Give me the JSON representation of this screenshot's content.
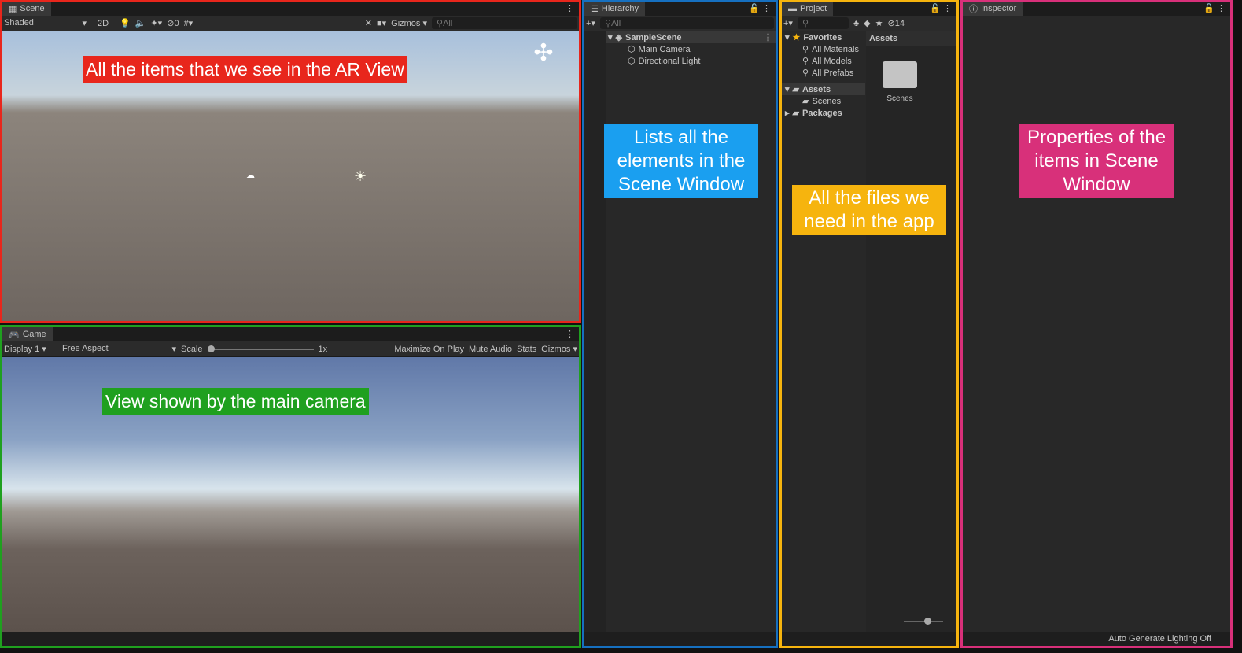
{
  "scene": {
    "tab": "Scene",
    "shading": "Shaded",
    "mode_2d": "2D",
    "hidden_count": "0",
    "gizmos": "Gizmos",
    "search_placeholder": "All",
    "annotation": "All the items that we see in the AR View",
    "annotation_color": "#e8261c",
    "border_color": "#e8261c"
  },
  "game": {
    "tab": "Game",
    "display": "Display 1",
    "aspect": "Free Aspect",
    "scale_label": "Scale",
    "scale_value": "1x",
    "maximize": "Maximize On Play",
    "mute": "Mute Audio",
    "stats": "Stats",
    "gizmos": "Gizmos",
    "annotation": "View shown by the main camera",
    "annotation_color": "#1fa01f",
    "border_color": "#1fa01f"
  },
  "hierarchy": {
    "tab": "Hierarchy",
    "search_placeholder": "All",
    "scene_name": "SampleScene",
    "items": [
      "Main Camera",
      "Directional Light"
    ],
    "annotation": "Lists all the elements in the Scene Window",
    "annotation_color": "#1a9ff0",
    "border_color": "#1670c0"
  },
  "project": {
    "tab": "Project",
    "hidden_count": "14",
    "favorites": "Favorites",
    "favorite_items": [
      "All Materials",
      "All Models",
      "All Prefabs"
    ],
    "assets": "Assets",
    "asset_children": [
      "Scenes"
    ],
    "packages": "Packages",
    "assets_header": "Assets",
    "folder_label": "Scenes",
    "annotation": "All the files we need in the app",
    "annotation_color": "#f6b40e",
    "border_color": "#f6b40e"
  },
  "inspector": {
    "tab": "Inspector",
    "status": "Auto Generate Lighting Off",
    "annotation": "Properties of the items in Scene Window",
    "annotation_color": "#d8307a",
    "border_color": "#d8307a"
  }
}
